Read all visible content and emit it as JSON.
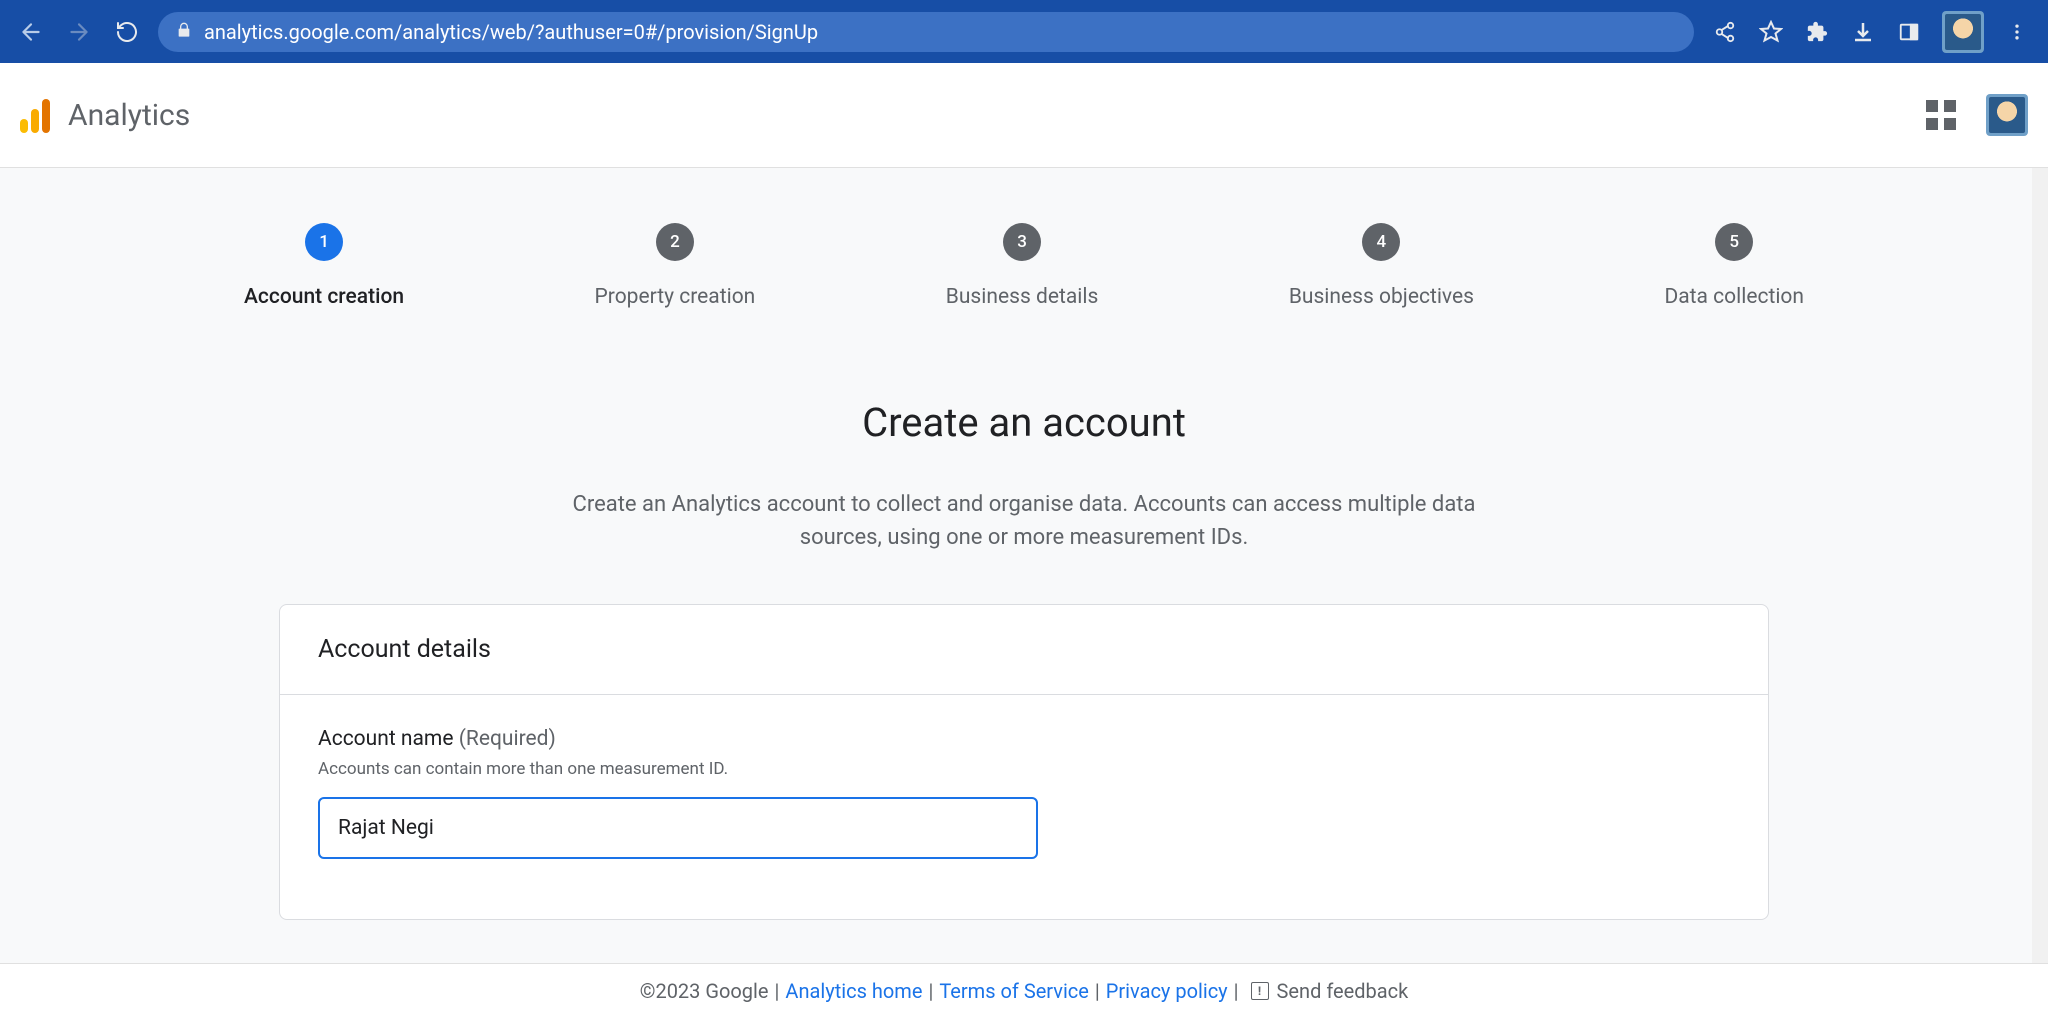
{
  "browser": {
    "url": "analytics.google.com/analytics/web/?authuser=0#/provision/SignUp"
  },
  "header": {
    "appName": "Analytics"
  },
  "stepper": {
    "steps": [
      {
        "num": "1",
        "label": "Account creation",
        "active": true
      },
      {
        "num": "2",
        "label": "Property creation",
        "active": false
      },
      {
        "num": "3",
        "label": "Business details",
        "active": false
      },
      {
        "num": "4",
        "label": "Business objectives",
        "active": false
      },
      {
        "num": "5",
        "label": "Data collection",
        "active": false
      }
    ]
  },
  "main": {
    "title": "Create an account",
    "description": "Create an Analytics account to collect and organise data. Accounts can access multiple data sources, using one or more measurement IDs."
  },
  "card": {
    "title": "Account details",
    "fieldLabel": "Account name",
    "fieldRequired": " (Required)",
    "fieldHint": "Accounts can contain more than one measurement ID.",
    "fieldValue": "Rajat Negi"
  },
  "footer": {
    "copyright": "©2023 Google",
    "links": {
      "home": "Analytics home",
      "tos": "Terms of Service",
      "privacy": "Privacy policy"
    },
    "feedback": "Send feedback",
    "feedbackIcon": "!"
  }
}
